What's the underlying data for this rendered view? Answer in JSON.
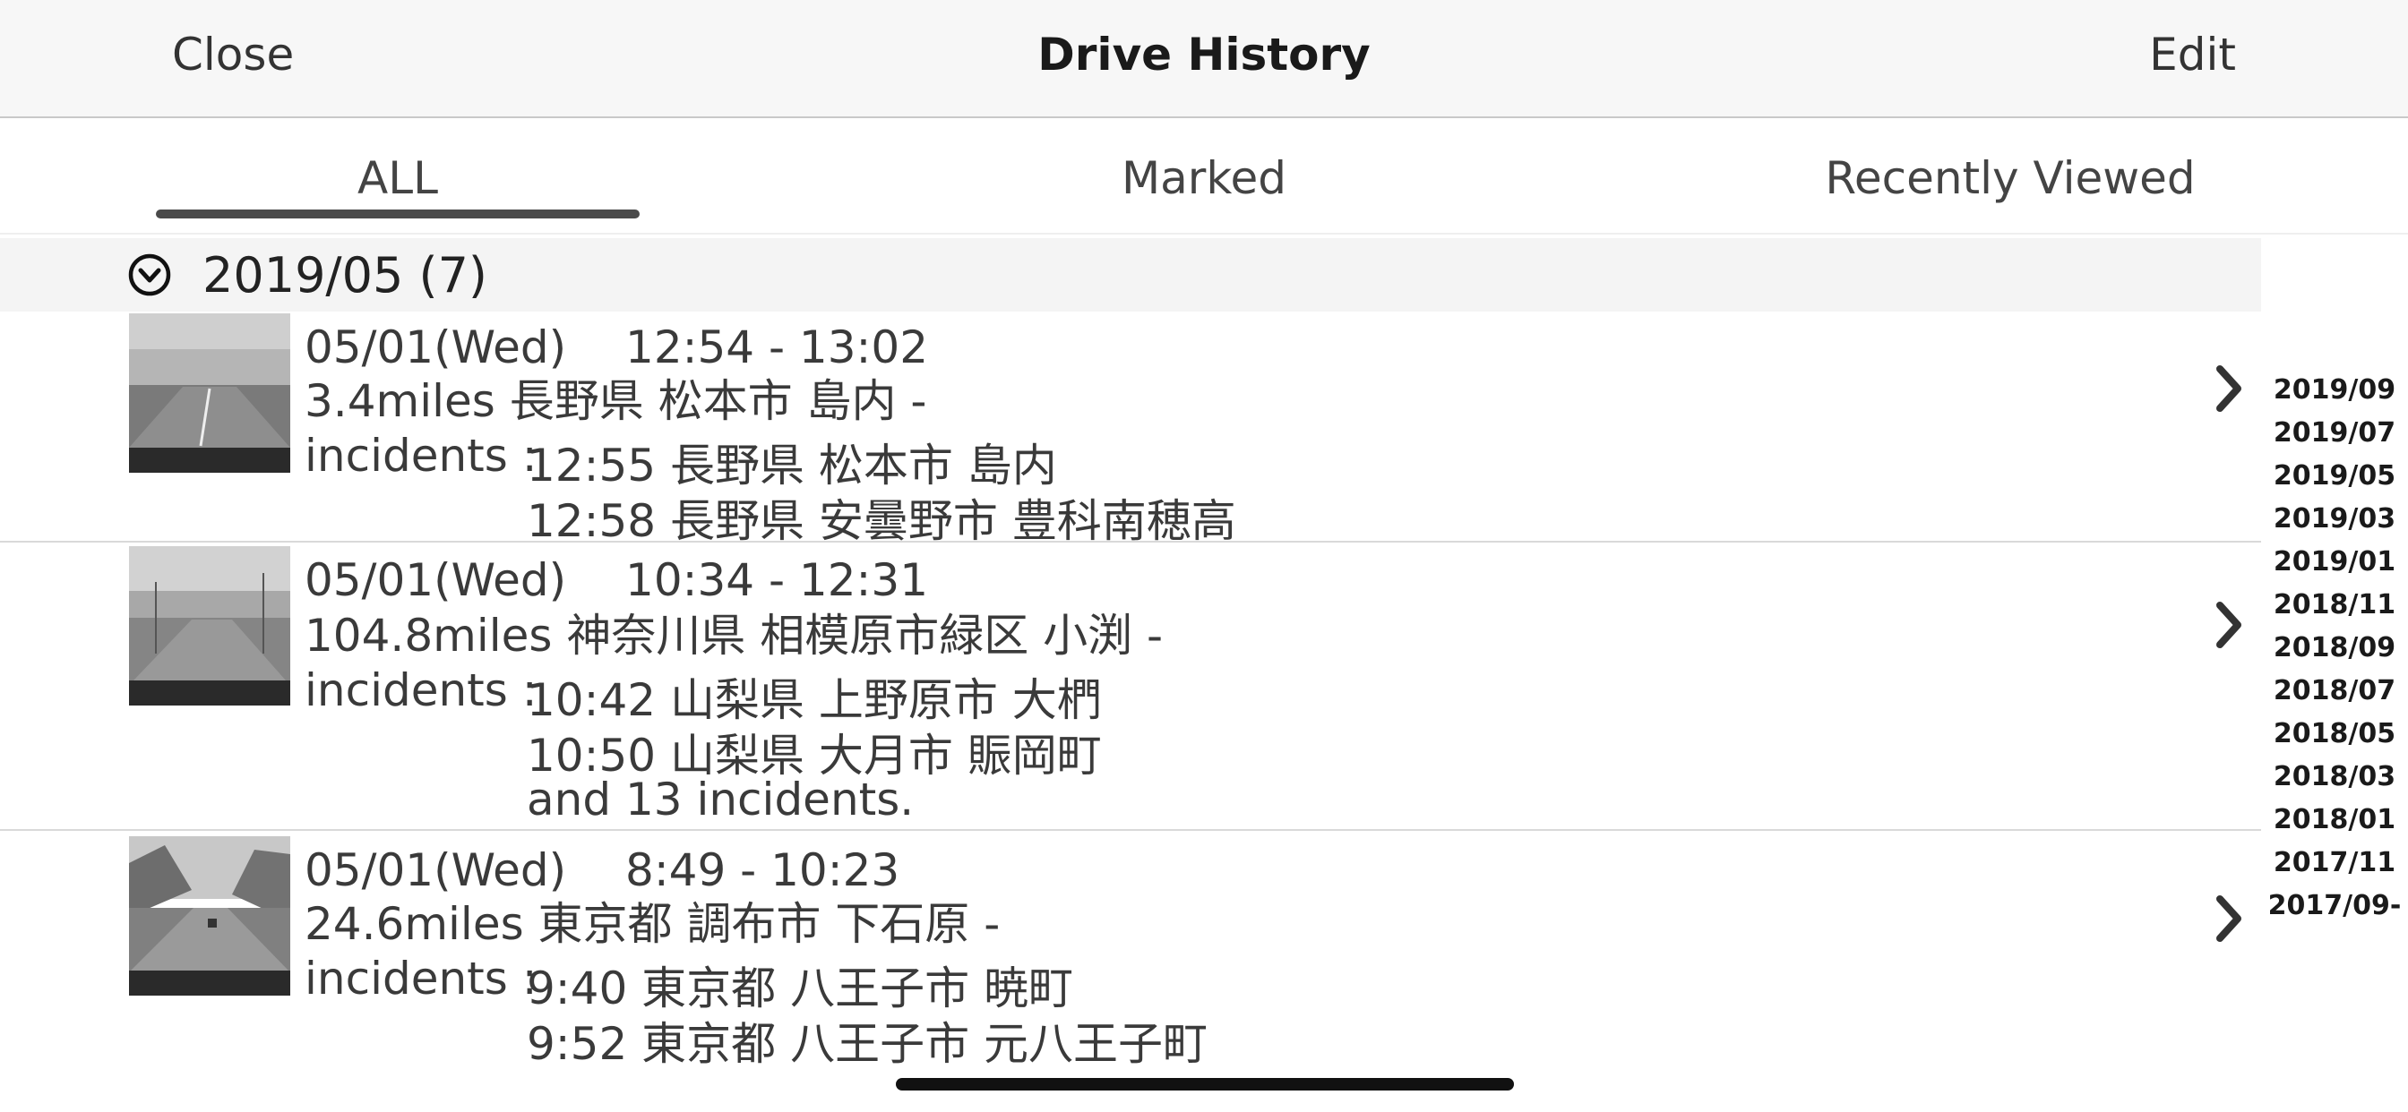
{
  "nav": {
    "close": "Close",
    "title": "Drive History",
    "edit": "Edit"
  },
  "tabs": [
    {
      "label": "ALL",
      "active": true
    },
    {
      "label": "Marked",
      "active": false
    },
    {
      "label": "Recently Viewed",
      "active": false
    }
  ],
  "section": {
    "label": "2019/05 (7)",
    "icon": "chevron-down-circle-icon"
  },
  "drives": [
    {
      "date_time": "05/01(Wed)　 12:54 - 13:02",
      "distance_route": "3.4miles 長野県 松本市 島内 -",
      "incidents_label": "incidents :",
      "incidents": [
        "12:55 長野県 松本市 島内",
        "12:58 長野県 安曇野市 豊科南穂高"
      ]
    },
    {
      "date_time": "05/01(Wed)　 10:34 - 12:31",
      "distance_route": "104.8miles 神奈川県 相模原市緑区 小渕 -",
      "incidents_label": "incidents :",
      "incidents": [
        "10:42 山梨県 上野原市 大椚",
        "10:50 山梨県 大月市 賑岡町",
        "and 13 incidents."
      ]
    },
    {
      "date_time": "05/01(Wed)　 8:49 - 10:23",
      "distance_route": "24.6miles 東京都 調布市 下石原 -",
      "incidents_label": "incidents :",
      "incidents": [
        "9:40 東京都 八王子市 暁町",
        "9:52 東京都 八王子市 元八王子町"
      ]
    }
  ],
  "index": [
    "2019/09",
    "2019/07",
    "2019/05",
    "2019/03",
    "2019/01",
    "2018/11",
    "2018/09",
    "2018/07",
    "2018/05",
    "2018/03",
    "2018/01",
    "2017/11",
    "2017/09-"
  ]
}
